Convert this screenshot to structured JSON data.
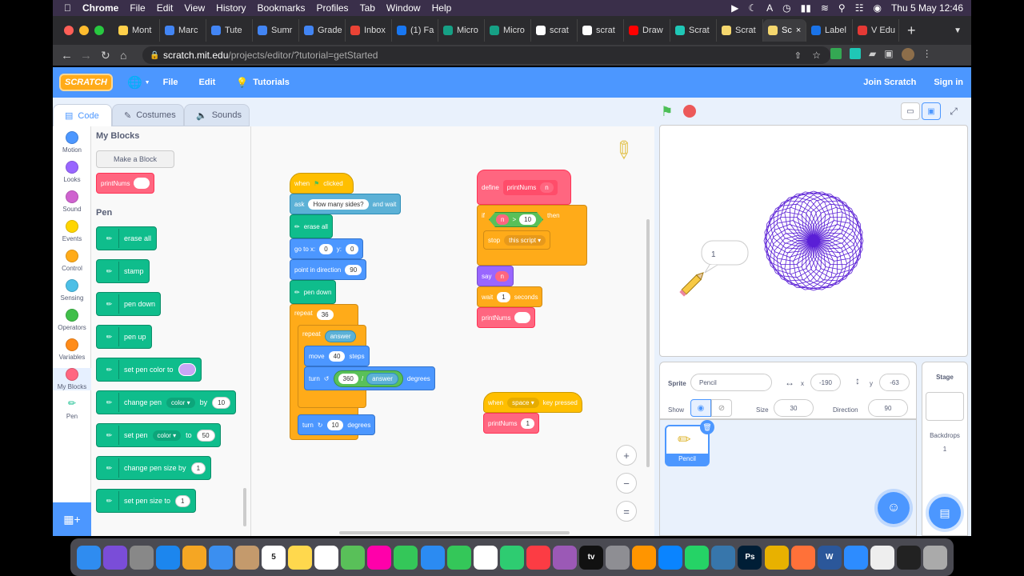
{
  "menubar": {
    "app": "Chrome",
    "items": [
      "File",
      "Edit",
      "View",
      "History",
      "Bookmarks",
      "Profiles",
      "Tab",
      "Window",
      "Help"
    ],
    "clock": "Thu 5 May  12:46"
  },
  "tabs": [
    {
      "label": "Mont",
      "color": "#ffd04a"
    },
    {
      "label": "Marc",
      "color": "#4285f4"
    },
    {
      "label": "Tute",
      "color": "#4285f4"
    },
    {
      "label": "Sumr",
      "color": "#4285f4"
    },
    {
      "label": "Grade",
      "color": "#4285f4"
    },
    {
      "label": "Inbox",
      "color": "#ea4335"
    },
    {
      "label": "(1) Fa",
      "color": "#1877f2"
    },
    {
      "label": "Micro",
      "color": "#16a085"
    },
    {
      "label": "Micro",
      "color": "#16a085"
    },
    {
      "label": "scrat",
      "color": "#ffffff"
    },
    {
      "label": "scrat",
      "color": "#ffffff"
    },
    {
      "label": "Draw",
      "color": "#ff0000"
    },
    {
      "label": "Scrat",
      "color": "#1fc7b6"
    },
    {
      "label": "Scrat",
      "color": "#f5d76e"
    },
    {
      "label": "Sc",
      "color": "#f5d76e",
      "active": true
    },
    {
      "label": "Label",
      "color": "#1a73e8"
    },
    {
      "label": "V Edu",
      "color": "#e53935"
    }
  ],
  "url": {
    "host": "scratch.mit.edu",
    "path": "/projects/editor/?tutorial=getStarted"
  },
  "header": {
    "logo": "SCRATCH",
    "file": "File",
    "edit": "Edit",
    "tutorials": "Tutorials",
    "join": "Join Scratch",
    "signin": "Sign in"
  },
  "editor_tabs": {
    "code": "Code",
    "costumes": "Costumes",
    "sounds": "Sounds"
  },
  "categories": [
    {
      "label": "Motion",
      "color": "#4c97ff"
    },
    {
      "label": "Looks",
      "color": "#9966ff"
    },
    {
      "label": "Sound",
      "color": "#cf63cf"
    },
    {
      "label": "Events",
      "color": "#ffd500"
    },
    {
      "label": "Control",
      "color": "#ffab19"
    },
    {
      "label": "Sensing",
      "color": "#4cbfe6"
    },
    {
      "label": "Operators",
      "color": "#40bf4a"
    },
    {
      "label": "Variables",
      "color": "#ff8c1a"
    },
    {
      "label": "My Blocks",
      "color": "#ff6680"
    },
    {
      "label": "Pen",
      "color": "#0fbd8c"
    }
  ],
  "flyout": {
    "my_blocks_heading": "My Blocks",
    "make_block": "Make a Block",
    "print_nums": "printNums",
    "pen_heading": "Pen",
    "erase_all": "erase all",
    "stamp": "stamp",
    "pen_down": "pen down",
    "pen_up": "pen up",
    "set_pen_color_to": "set pen color to",
    "change_pen": "change pen",
    "color": "color",
    "by": "by",
    "ten": "10",
    "set_pen": "set pen",
    "to": "to",
    "fifty": "50",
    "change_pen_size_by": "change pen size by",
    "one": "1",
    "set_pen_size_to": "set pen size to"
  },
  "script1": {
    "when": "when",
    "clicked": "clicked",
    "ask": "ask",
    "question": "How many sides?",
    "and_wait": "and wait",
    "erase_all": "erase all",
    "go_to_x": "go to x:",
    "x": "0",
    "y_label": "y:",
    "y": "0",
    "point_in_direction": "point in direction",
    "dir": "90",
    "pen_down": "pen down",
    "repeat": "repeat",
    "repeat_count": "36",
    "answer": "answer",
    "move": "move",
    "move_steps": "40",
    "steps": "steps",
    "turn": "turn",
    "deg_num": "360",
    "slash": "/",
    "degrees": "degrees",
    "turn2": "turn",
    "deg2": "10"
  },
  "script2": {
    "define": "define",
    "print_nums": "printNums",
    "n": "n",
    "if": "if",
    "gt": ">",
    "ten": "10",
    "then": "then",
    "stop": "stop",
    "this_script": "this script",
    "say": "say",
    "wait": "wait",
    "one": "1",
    "seconds": "seconds"
  },
  "script3": {
    "when": "when",
    "key": "space",
    "key_pressed": "key pressed",
    "print_nums": "printNums",
    "arg": "1"
  },
  "zoom": {
    "in": "+",
    "out": "−",
    "reset": "="
  },
  "stage": {
    "speech": "1"
  },
  "sprite_info": {
    "sprite_label": "Sprite",
    "sprite_name": "Pencil",
    "x_label": "x",
    "x": "-190",
    "y_label": "y",
    "y": "-63",
    "show_label": "Show",
    "size_label": "Size",
    "size": "30",
    "direction_label": "Direction",
    "direction": "90"
  },
  "sprite_list": {
    "thumb_name": "Pencil"
  },
  "stage_panel": {
    "title": "Stage",
    "backdrops": "Backdrops",
    "count": "1"
  },
  "dock": [
    {
      "icon": "finder-icon",
      "color": "#2f8cf0"
    },
    {
      "icon": "siri-icon",
      "color": "#7a4dd8"
    },
    {
      "icon": "launchpad-icon",
      "color": "#888"
    },
    {
      "icon": "safari-icon",
      "color": "#1c86ee"
    },
    {
      "icon": "c-app-icon",
      "color": "#f5a623"
    },
    {
      "icon": "mail-icon",
      "color": "#3b8ff0"
    },
    {
      "icon": "contacts-icon",
      "color": "#c49a6c"
    },
    {
      "icon": "calendar-icon",
      "color": "#fff",
      "text": "5"
    },
    {
      "icon": "notes-icon",
      "color": "#ffd84d"
    },
    {
      "icon": "reminders-icon",
      "color": "#fff"
    },
    {
      "icon": "maps-icon",
      "color": "#59c059"
    },
    {
      "icon": "photos-icon",
      "color": "#f0a"
    },
    {
      "icon": "messages-icon",
      "color": "#34c759"
    },
    {
      "icon": "keynote-icon",
      "color": "#2b8bf2"
    },
    {
      "icon": "facetime-icon",
      "color": "#34c759"
    },
    {
      "icon": "freeform-icon",
      "color": "#fff"
    },
    {
      "icon": "numbers-icon",
      "color": "#2ecc71"
    },
    {
      "icon": "music-icon",
      "color": "#fc3c44"
    },
    {
      "icon": "podcasts-icon",
      "color": "#9b59b6"
    },
    {
      "icon": "tv-icon",
      "color": "#111",
      "text": "tv"
    },
    {
      "icon": "settings-icon",
      "color": "#8e8e93"
    },
    {
      "icon": "books-icon",
      "color": "#ff9500"
    },
    {
      "icon": "appstore-icon",
      "color": "#0a84ff"
    },
    {
      "icon": "whatsapp-icon",
      "color": "#25d366"
    },
    {
      "icon": "python-icon",
      "color": "#3776ab"
    },
    {
      "icon": "photoshop-icon",
      "color": "#001e36",
      "text": "Ps"
    },
    {
      "icon": "chrome-icon",
      "color": "#e8b100"
    },
    {
      "icon": "firefox-icon",
      "color": "#ff7139"
    },
    {
      "icon": "word-icon",
      "color": "#2b579a",
      "text": "W"
    },
    {
      "icon": "zoom-icon",
      "color": "#2d8cff"
    },
    {
      "icon": "document-icon",
      "color": "#eee"
    },
    {
      "icon": "terminal-icon",
      "color": "#222"
    },
    {
      "icon": "trash-icon",
      "color": "#aaa"
    }
  ]
}
